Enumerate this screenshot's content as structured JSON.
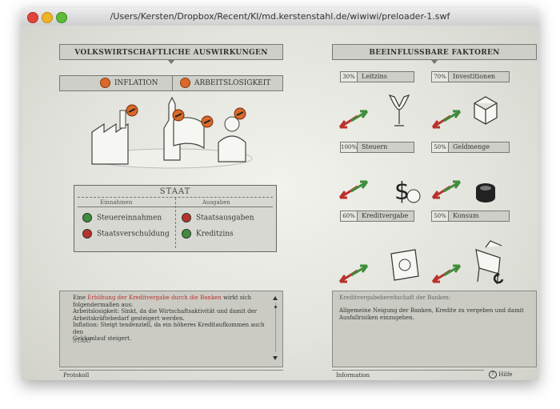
{
  "window": {
    "title": "/Users/Kersten/Dropbox/Recent/KI/md.kerstenstahl.de/wiwiwi/preloader-1.swf"
  },
  "left": {
    "header": "VOLKSWIRTSCHAFTLICHE AUSWIRKUNGEN",
    "tabs": [
      "INFLATION",
      "ARBEITSLOSIGKEIT"
    ]
  },
  "right": {
    "header": "BEEINFLUSSBARE FAKTOREN",
    "factors": [
      {
        "pct": "30%",
        "name": "Leitzins"
      },
      {
        "pct": "70%",
        "name": "Investitionen"
      },
      {
        "pct": "100%",
        "name": "Steuern"
      },
      {
        "pct": "50%",
        "name": "Geldmenge"
      },
      {
        "pct": "60%",
        "name": "Kreditvergabe"
      },
      {
        "pct": "50%",
        "name": "Konsum"
      }
    ]
  },
  "staat": {
    "title": "STAAT",
    "einnahmen": "Einnahmen",
    "ausgaben": "Ausgaben",
    "items": [
      "Steuereinnahmen",
      "Staatsverschuldung",
      "Staatsausgaben",
      "Kreditzins"
    ]
  },
  "protocol": {
    "line1_pre": "Eine ",
    "line1_hl": "Erhöhung der Kreditvergabe durch die Banken",
    "line1_post": " wirkt sich",
    "line2": "folgendermaßen aus:",
    "line3": "Arbeitslosigkeit: Sinkt, da die Wirtschaftsaktivität und damit der",
    "line4": "Arbeitskräftebedarf gesteigert werden.",
    "line5": "Inflation: Steigt tendenziell, da ein höheres Kreditaufkommen auch den",
    "line6": "Geldumlauf steigert.",
    "staat": "STAAT",
    "tab": "Protokoll"
  },
  "info": {
    "title": "Kreditvergabebereitschaft der Banken:",
    "line1": "Allgemeine Neigung der Banken, Kredite zu vergeben und damit",
    "line2": "Ausfallrisiken einzugehen.",
    "tab": "Information",
    "help": "Hilfe"
  },
  "colors": {
    "orange": "#d86a2b",
    "green": "#3f8d3a",
    "red": "#b8322c",
    "highlight": "#b8322c"
  }
}
